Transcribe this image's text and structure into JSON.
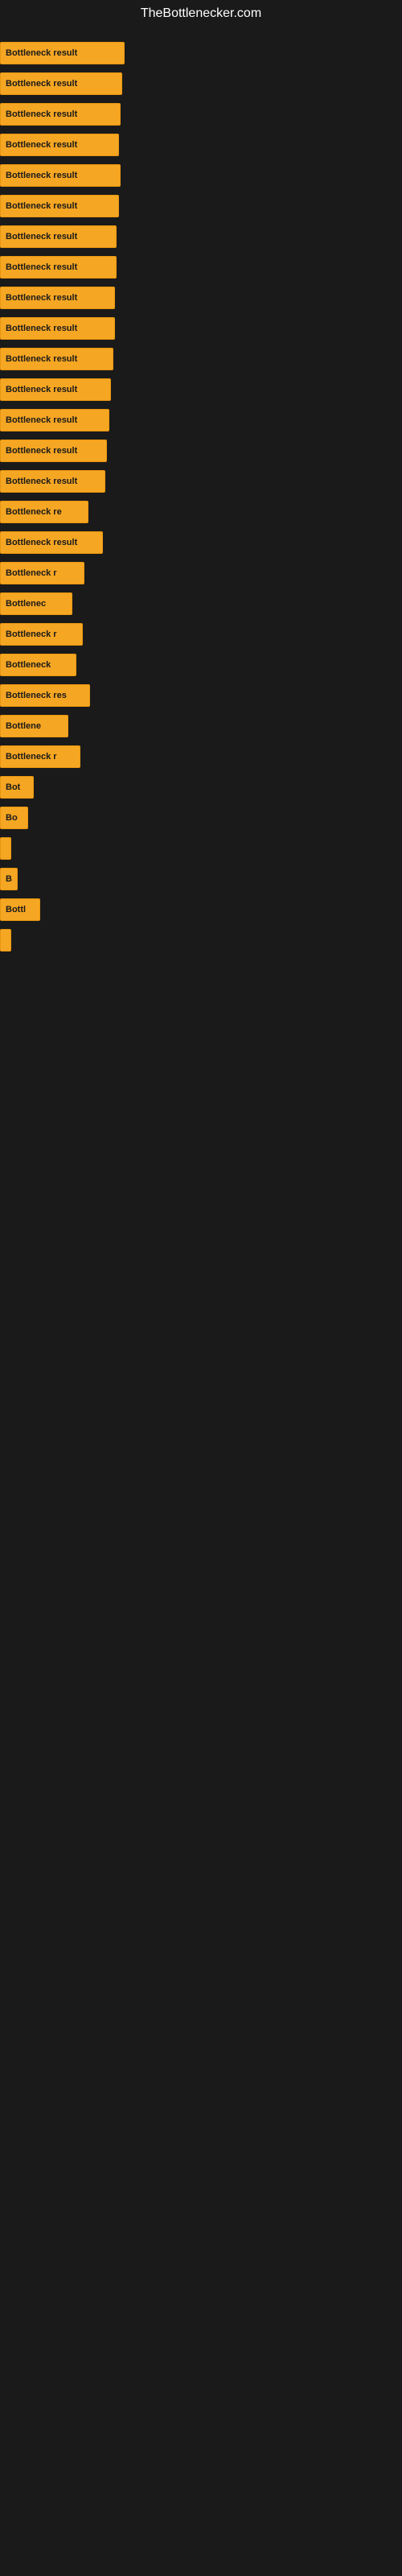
{
  "site": {
    "title": "TheBottlenecker.com"
  },
  "bars": [
    {
      "label": "Bottleneck result",
      "width": 155
    },
    {
      "label": "Bottleneck result",
      "width": 152
    },
    {
      "label": "Bottleneck result",
      "width": 150
    },
    {
      "label": "Bottleneck result",
      "width": 148
    },
    {
      "label": "Bottleneck result",
      "width": 150
    },
    {
      "label": "Bottleneck result",
      "width": 148
    },
    {
      "label": "Bottleneck result",
      "width": 145
    },
    {
      "label": "Bottleneck result",
      "width": 145
    },
    {
      "label": "Bottleneck result",
      "width": 143
    },
    {
      "label": "Bottleneck result",
      "width": 143
    },
    {
      "label": "Bottleneck result",
      "width": 141
    },
    {
      "label": "Bottleneck result",
      "width": 138
    },
    {
      "label": "Bottleneck result",
      "width": 136
    },
    {
      "label": "Bottleneck result",
      "width": 133
    },
    {
      "label": "Bottleneck result",
      "width": 131
    },
    {
      "label": "Bottleneck re",
      "width": 110
    },
    {
      "label": "Bottleneck result",
      "width": 128
    },
    {
      "label": "Bottleneck r",
      "width": 105
    },
    {
      "label": "Bottlenec",
      "width": 90
    },
    {
      "label": "Bottleneck r",
      "width": 103
    },
    {
      "label": "Bottleneck",
      "width": 95
    },
    {
      "label": "Bottleneck res",
      "width": 112
    },
    {
      "label": "Bottlene",
      "width": 85
    },
    {
      "label": "Bottleneck r",
      "width": 100
    },
    {
      "label": "Bot",
      "width": 42
    },
    {
      "label": "Bo",
      "width": 35
    },
    {
      "label": "",
      "width": 8
    },
    {
      "label": "B",
      "width": 22
    },
    {
      "label": "Bottl",
      "width": 50
    },
    {
      "label": "",
      "width": 5
    }
  ]
}
